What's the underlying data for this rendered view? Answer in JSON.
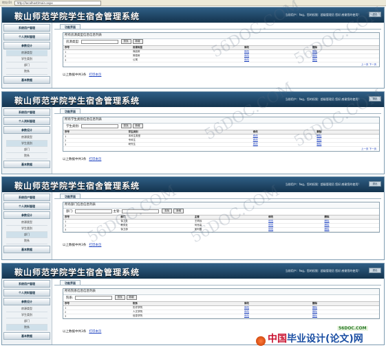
{
  "browser": {
    "address_label": "地址(D)",
    "url": "http://localhost/main.aspx"
  },
  "app": {
    "title": "鞍山师范学院学生宿舍管理系统",
    "user_text": "当前用户：fwg，您的权限：超级管理员 您好,感谢您的使用!",
    "exit_label": "退出"
  },
  "sidebar": {
    "groups": [
      "系统用户管理",
      "个人资料管理",
      "参数设计"
    ],
    "items": [
      "房源类型",
      "学生类别",
      "部门",
      "院系"
    ],
    "bottom_group": "基本数据"
  },
  "tab_label": "功能界面",
  "panels": [
    {
      "list_title": "所有房源类型信息信息列表",
      "search_labels": [
        "房源类型:"
      ],
      "search_button": "查找",
      "add_button": "新增",
      "columns": [
        "序号",
        "房源类型",
        "修改",
        "删除"
      ],
      "rows": [
        [
          "1",
          "商品房",
          "修改",
          "删除"
        ],
        [
          "2",
          "简易房",
          "修改",
          "删除"
        ],
        [
          "3",
          "公寓",
          "修改",
          "删除"
        ]
      ],
      "pager": "上一页 下一页",
      "footer_text": "以上数据中共3条",
      "print_link": "打印本页"
    },
    {
      "list_title": "所有学生类别信息信息列表",
      "search_labels": [
        "学生类别:"
      ],
      "search_button": "查找",
      "add_button": "新增",
      "columns": [
        "序号",
        "学生类别",
        "修改",
        "删除"
      ],
      "rows": [
        [
          "1",
          "本科生类型",
          "修改",
          "删除"
        ],
        [
          "2",
          "专科生",
          "修改",
          "删除"
        ],
        [
          "3",
          "研究生",
          "修改",
          "删除"
        ]
      ],
      "pager": "上一页 下一页",
      "footer_text": "以上数据中共3条",
      "print_link": "打印本页"
    },
    {
      "list_title": "所有部门信息信息列表",
      "search_labels": [
        "部门:",
        "主管:"
      ],
      "search_button": "查找",
      "add_button": "新增",
      "columns": [
        "序号",
        "部门",
        "主管",
        "修改",
        "删除"
      ],
      "rows": [
        [
          "1",
          "保卫处",
          "王明远",
          "修改",
          "删除"
        ],
        [
          "2",
          "教务处",
          "何世高",
          "修改",
          "删除"
        ],
        [
          "3",
          "保卫部",
          "吴利国",
          "修改",
          "删除"
        ]
      ],
      "pager": "",
      "footer_text": "以上数据中共3条",
      "print_link": "打印本页"
    },
    {
      "list_title": "所有院系信息信息列表",
      "search_labels": [
        "院系:"
      ],
      "search_button": "查找",
      "add_button": "新增",
      "columns": [
        "序号",
        "院系",
        "修改",
        "删除"
      ],
      "rows": [
        [
          "1",
          "历史学院",
          "修改",
          "删除"
        ],
        [
          "2",
          "人文学院",
          "修改",
          "删除"
        ],
        [
          "3",
          "信息学院",
          "修改",
          "删除"
        ]
      ],
      "pager": "",
      "footer_text": "以上数据中共3条",
      "print_link": "打印本页"
    }
  ],
  "watermarks": [
    "56DOC.COM",
    "56DOC.COM",
    "56DOC.COM",
    "56DOC.COM",
    "56DOC.COM",
    "56DOC.COM"
  ],
  "brand": {
    "prefix": "中国",
    "name": "毕业设计(论文)网",
    "site": "56DOC.COM"
  },
  "colors": {
    "header_top": "#2f5e85",
    "header_bottom": "#14344e",
    "link": "#1a3fbf"
  }
}
